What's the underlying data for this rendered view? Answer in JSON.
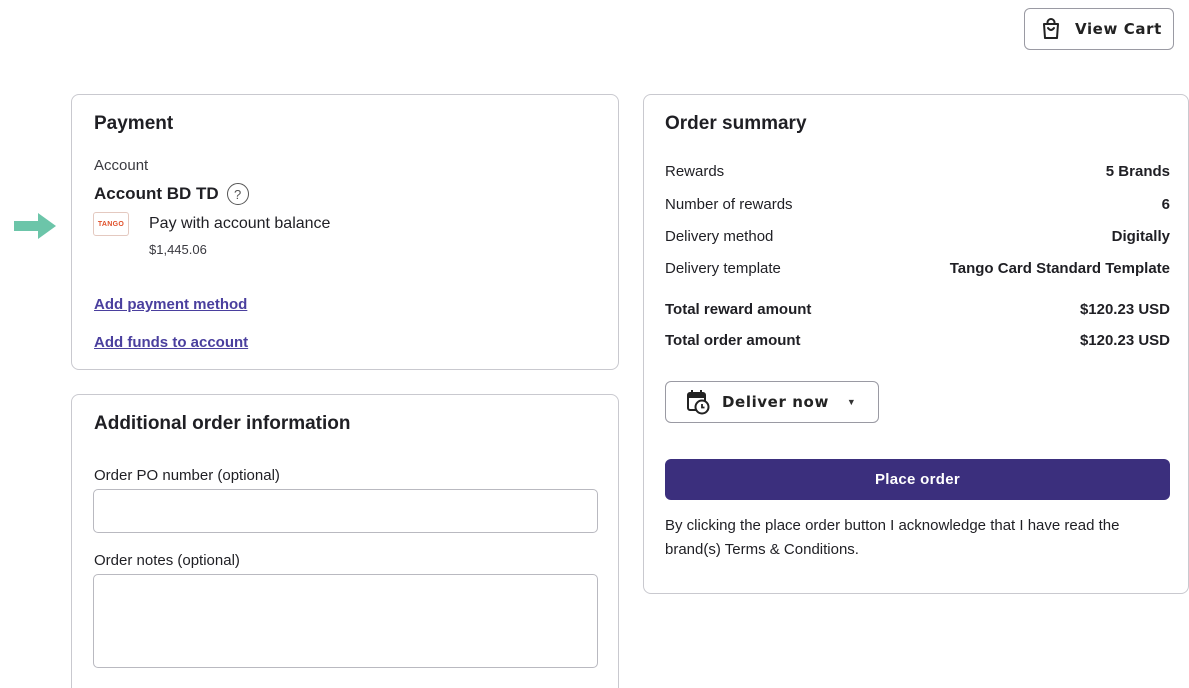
{
  "header": {
    "view_cart_label": "View Cart"
  },
  "payment": {
    "title": "Payment",
    "account_label": "Account",
    "account_name": "Account BD TD",
    "help_glyph": "?",
    "logo_text": "TANGO",
    "pay_option_label": "Pay with account balance",
    "balance": "$1,445.06",
    "add_payment_method_link": "Add payment method",
    "add_funds_link": "Add funds to account"
  },
  "additional": {
    "title": "Additional order information",
    "po_label": "Order PO number (optional)",
    "po_value": "",
    "notes_label": "Order notes (optional)",
    "notes_value": ""
  },
  "summary": {
    "title": "Order summary",
    "rows": [
      {
        "label": "Rewards",
        "value": "5 Brands"
      },
      {
        "label": "Number of rewards",
        "value": "6"
      },
      {
        "label": "Delivery method",
        "value": "Digitally"
      },
      {
        "label": "Delivery template",
        "value": "Tango Card Standard Template"
      },
      {
        "label": "Total reward amount",
        "value": "$120.23 USD"
      },
      {
        "label": "Total order amount",
        "value": "$120.23 USD"
      }
    ],
    "deliver_label": "Deliver now",
    "place_order_label": "Place order",
    "acknowledgement": "By clicking the place order button I acknowledge that I have read the brand(s) Terms & Conditions."
  },
  "colors": {
    "primary_button": "#3b2f7d",
    "link": "#4a3f9e",
    "arrow": "#5cbfa0",
    "tango_brand": "#e0502a"
  },
  "icons": {
    "view_cart": "shopping-bag-icon",
    "help": "help-circle-icon",
    "deliver": "calendar-clock-icon",
    "dropdown": "chevron-down-icon",
    "annotation": "arrow-right-icon"
  }
}
